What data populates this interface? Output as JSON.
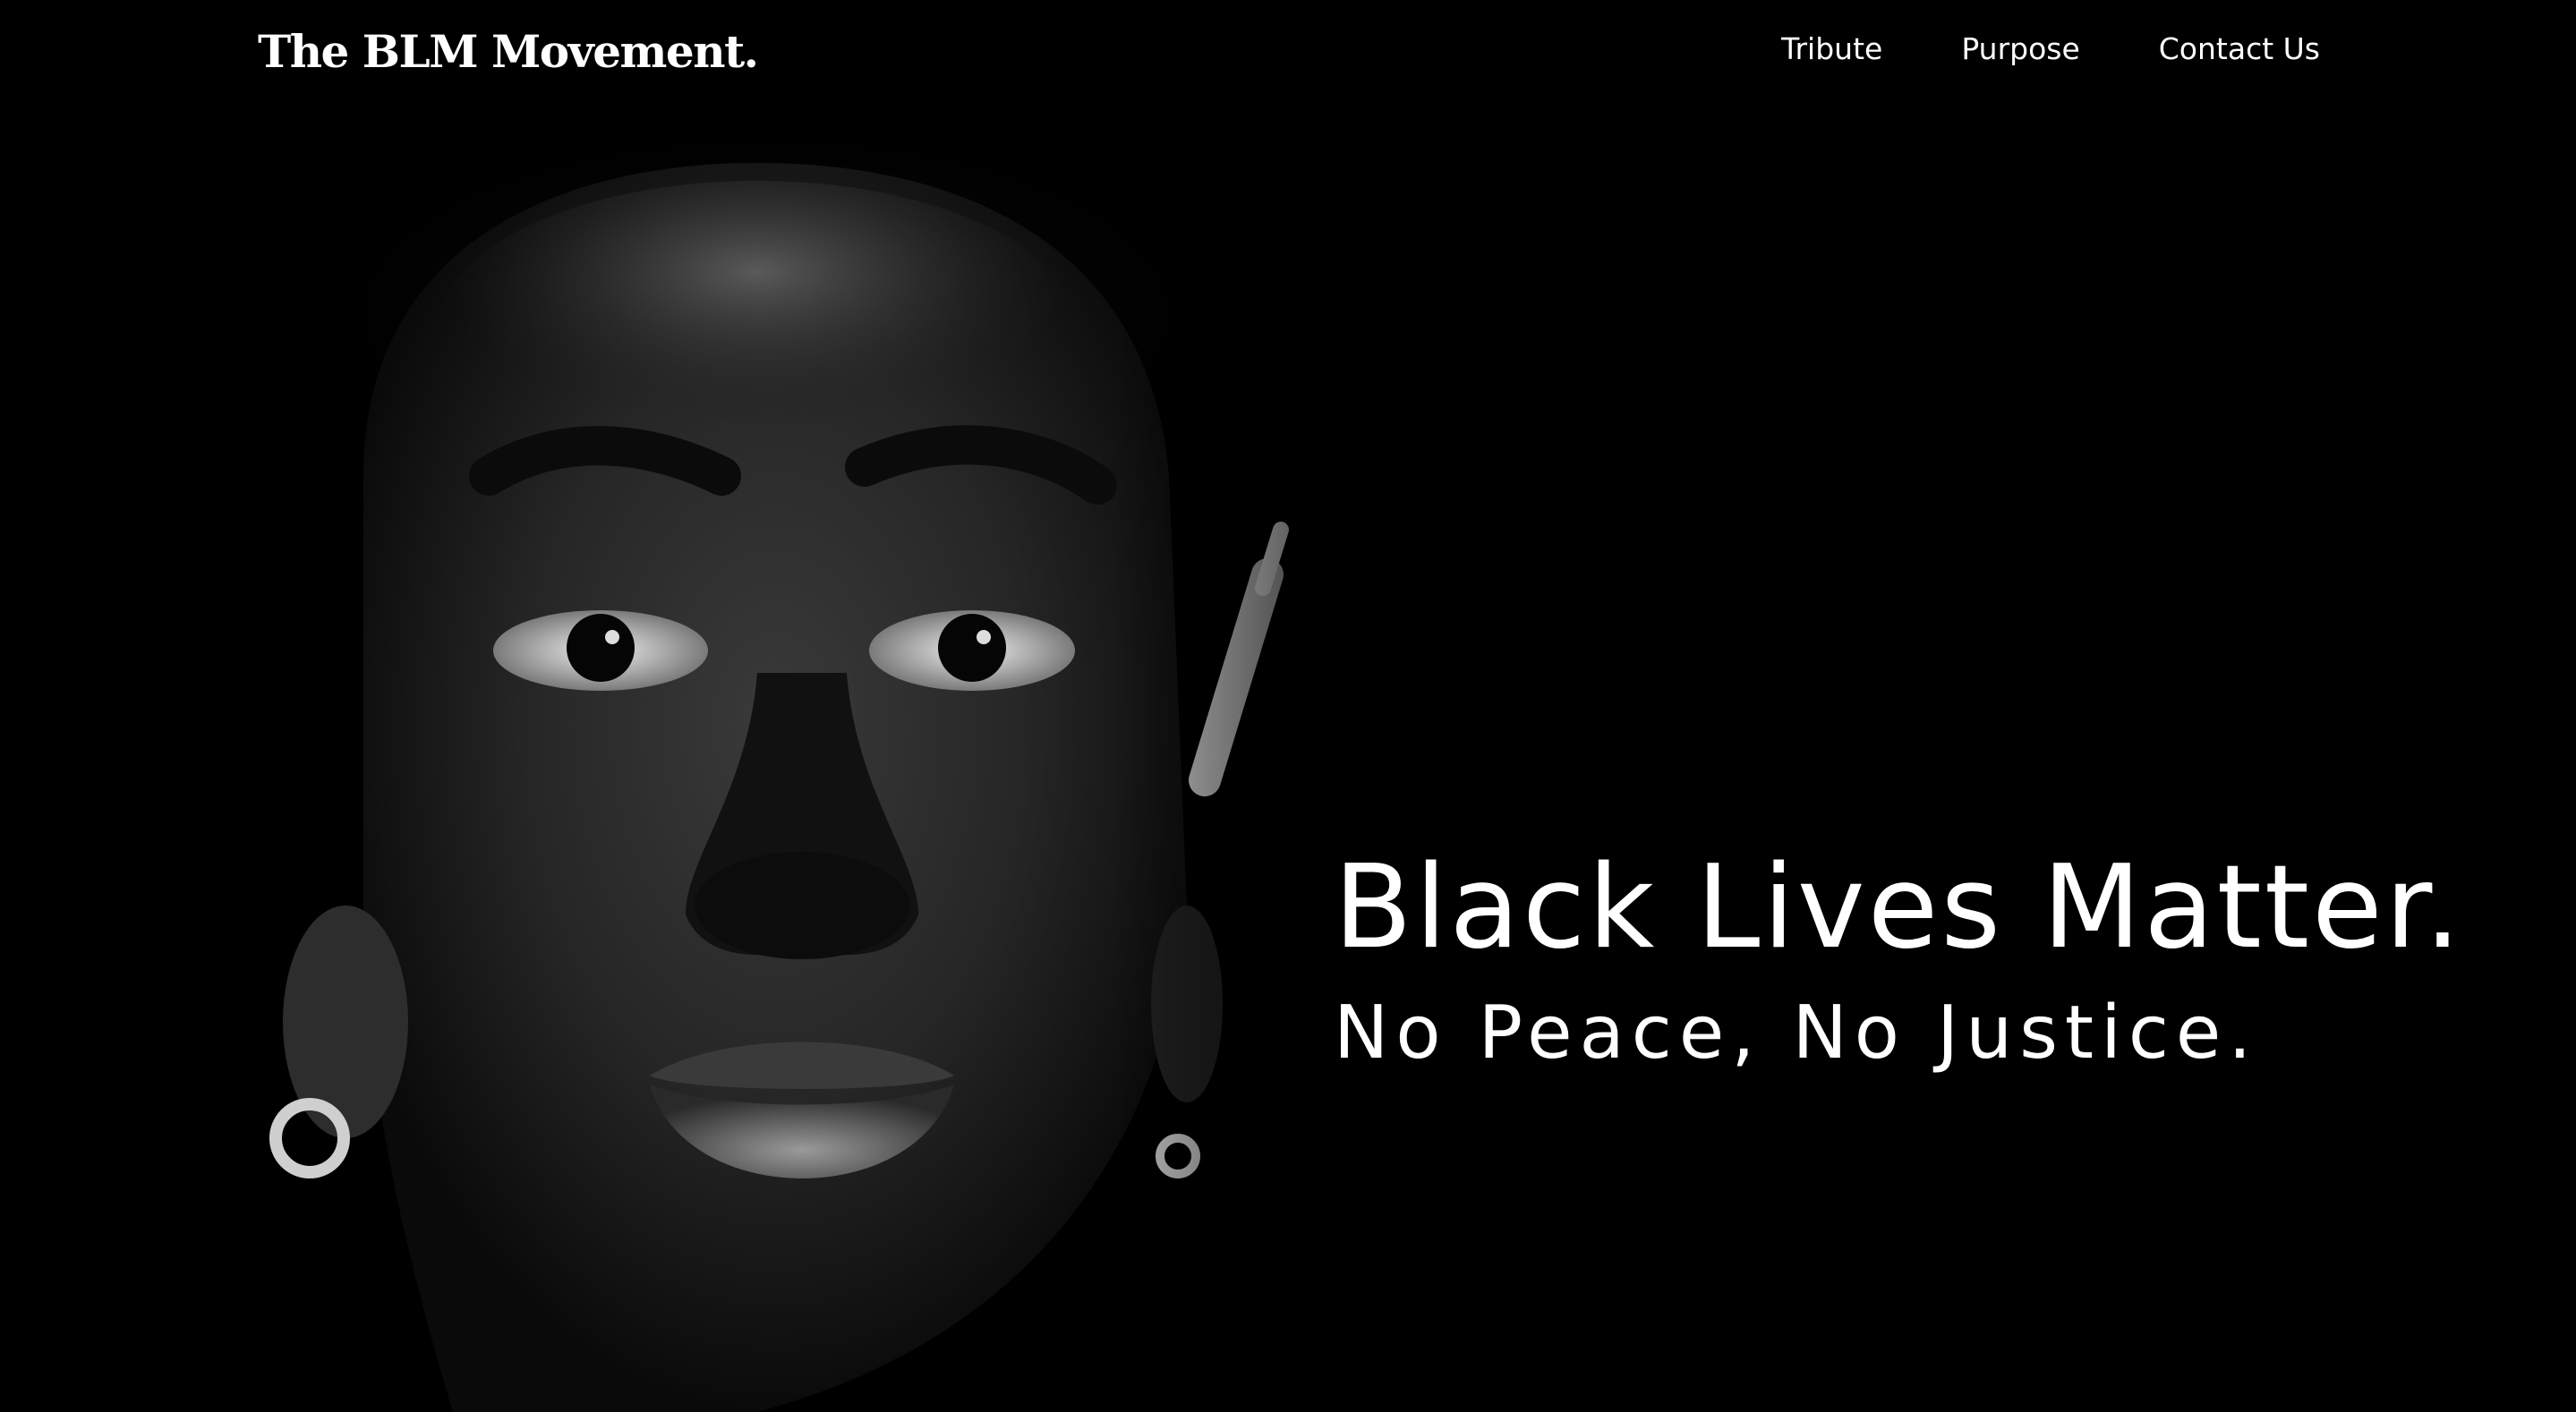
{
  "header": {
    "brand": "The BLM Movement.",
    "nav": [
      {
        "label": "Tribute"
      },
      {
        "label": "Purpose"
      },
      {
        "label": "Contact Us"
      }
    ]
  },
  "hero": {
    "title": "Black Lives Matter.",
    "subtitle": "No Peace, No Justice.",
    "image_alt": "black and white portrait photo"
  },
  "colors": {
    "background": "#000000",
    "text": "#ffffff"
  }
}
